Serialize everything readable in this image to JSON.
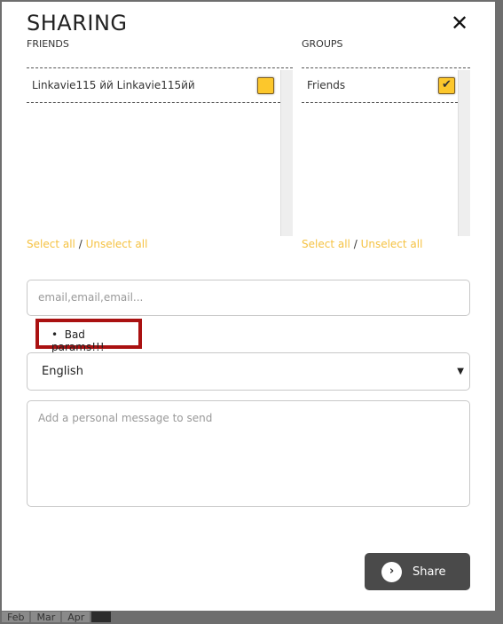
{
  "background_tabs": [
    "Feb",
    "Mar",
    "Apr"
  ],
  "modal": {
    "title": "SHARING",
    "close_icon": "close-icon"
  },
  "friends": {
    "label": "FRIENDS",
    "items": [
      {
        "name": "Linkavie115 йй Linkavie115йй",
        "checked": false
      }
    ],
    "select_all": "Select all",
    "separator": "/",
    "unselect_all": "Unselect all"
  },
  "groups": {
    "label": "GROUPS",
    "items": [
      {
        "name": "Friends",
        "checked": true
      }
    ],
    "select_all": "Select all",
    "separator": "/",
    "unselect_all": "Unselect all"
  },
  "emails": {
    "placeholder": "email,email,email...",
    "value": ""
  },
  "error": {
    "message": "Bad params!!!"
  },
  "language": {
    "selected": "English"
  },
  "message": {
    "placeholder": "Add a personal message to send",
    "value": ""
  },
  "share_button": {
    "label": "Share"
  },
  "colors": {
    "accent": "#fcc72c",
    "link": "#f5c242",
    "error_border": "#aa1111",
    "button": "#4a4a4a"
  }
}
